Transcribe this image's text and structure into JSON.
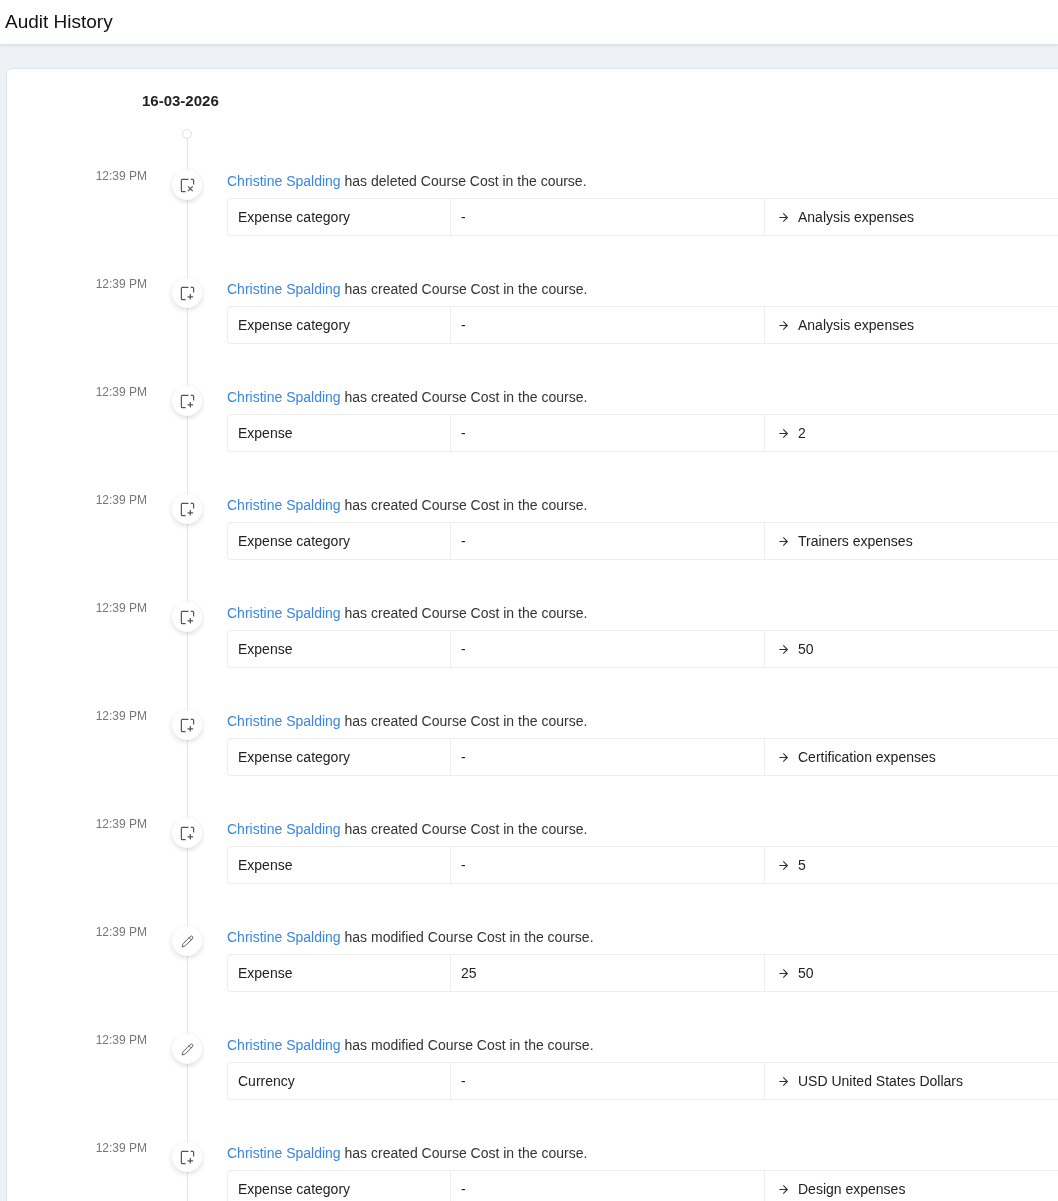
{
  "header": {
    "title": "Audit History"
  },
  "date": "16-03-2026",
  "entries": [
    {
      "time": "12:39 PM",
      "kind": "deleted",
      "user": "Christine Spalding",
      "text": "has deleted Course Cost in the course.",
      "field": "Expense category",
      "old": "-",
      "new": "Analysis expenses"
    },
    {
      "time": "12:39 PM",
      "kind": "created",
      "user": "Christine Spalding",
      "text": "has created Course Cost in the course.",
      "field": "Expense category",
      "old": "-",
      "new": "Analysis expenses"
    },
    {
      "time": "12:39 PM",
      "kind": "created",
      "user": "Christine Spalding",
      "text": "has created Course Cost in the course.",
      "field": "Expense",
      "old": "-",
      "new": "2"
    },
    {
      "time": "12:39 PM",
      "kind": "created",
      "user": "Christine Spalding",
      "text": "has created Course Cost in the course.",
      "field": "Expense category",
      "old": "-",
      "new": "Trainers expenses"
    },
    {
      "time": "12:39 PM",
      "kind": "created",
      "user": "Christine Spalding",
      "text": "has created Course Cost in the course.",
      "field": "Expense",
      "old": "-",
      "new": "50"
    },
    {
      "time": "12:39 PM",
      "kind": "created",
      "user": "Christine Spalding",
      "text": "has created Course Cost in the course.",
      "field": "Expense category",
      "old": "-",
      "new": "Certification expenses"
    },
    {
      "time": "12:39 PM",
      "kind": "created",
      "user": "Christine Spalding",
      "text": "has created Course Cost in the course.",
      "field": "Expense",
      "old": "-",
      "new": "5"
    },
    {
      "time": "12:39 PM",
      "kind": "modified",
      "user": "Christine Spalding",
      "text": "has modified Course Cost in the course.",
      "field": "Expense",
      "old": "25",
      "new": "50"
    },
    {
      "time": "12:39 PM",
      "kind": "modified",
      "user": "Christine Spalding",
      "text": "has modified Course Cost in the course.",
      "field": "Currency",
      "old": "-",
      "new": "USD United States Dollars"
    },
    {
      "time": "12:39 PM",
      "kind": "created",
      "user": "Christine Spalding",
      "text": "has created Course Cost in the course.",
      "field": "Expense category",
      "old": "-",
      "new": "Design expenses"
    }
  ]
}
